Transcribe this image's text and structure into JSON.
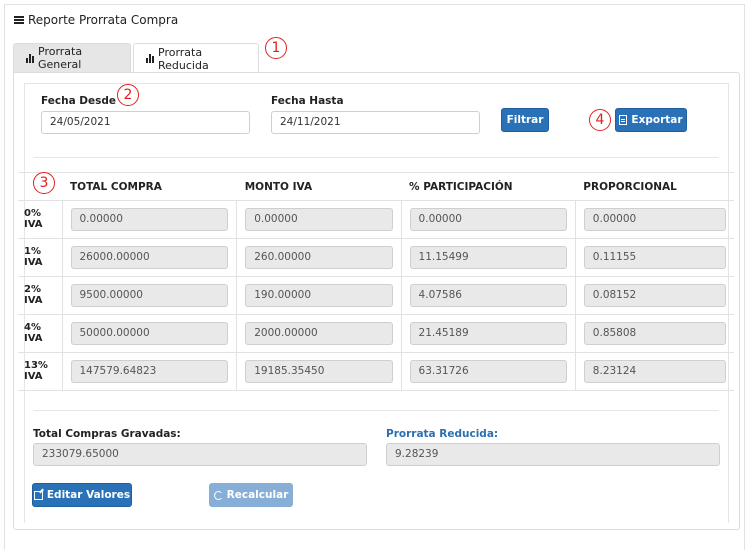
{
  "header": {
    "title": "Reporte Prorrata Compra",
    "icon": "list-icon"
  },
  "tabs": [
    {
      "label": "Prorrata General",
      "icon": "bar-chart-icon",
      "active": false
    },
    {
      "label": "Prorrata Reducida",
      "icon": "bar-chart-icon",
      "active": true
    }
  ],
  "filters": {
    "desde_label": "Fecha Desde",
    "desde_value": "24/05/2021",
    "hasta_label": "Fecha Hasta",
    "hasta_value": "24/11/2021",
    "filtrar_label": "Filtrar",
    "exportar_label": "Exportar"
  },
  "table": {
    "columns": [
      "TOTAL COMPRA",
      "MONTO IVA",
      "% PARTICIPACIÓN",
      "PROPORCIONAL"
    ],
    "rows": [
      {
        "label": "0% IVA",
        "values": [
          "0.00000",
          "0.00000",
          "0.00000",
          "0.00000"
        ]
      },
      {
        "label": "1% IVA",
        "values": [
          "26000.00000",
          "260.00000",
          "11.15499",
          "0.11155"
        ]
      },
      {
        "label": "2% IVA",
        "values": [
          "9500.00000",
          "190.00000",
          "4.07586",
          "0.08152"
        ]
      },
      {
        "label": "4% IVA",
        "values": [
          "50000.00000",
          "2000.00000",
          "21.45189",
          "0.85808"
        ]
      },
      {
        "label": "13% IVA",
        "values": [
          "147579.64823",
          "19185.35450",
          "63.31726",
          "8.23124"
        ]
      }
    ]
  },
  "totals": {
    "gravadas_label": "Total Compras Gravadas:",
    "gravadas_value": "233079.65000",
    "prorrata_label": "Prorrata Reducida:",
    "prorrata_value": "9.28239"
  },
  "actions": {
    "editar_label": "Editar Valores",
    "recalcular_label": "Recalcular"
  },
  "callouts": [
    "1",
    "2",
    "3",
    "4"
  ],
  "colors": {
    "primary": "#2a72b8",
    "disabled": "#87aed6",
    "callout": "#e02020",
    "link_label": "#2a6fb0"
  }
}
